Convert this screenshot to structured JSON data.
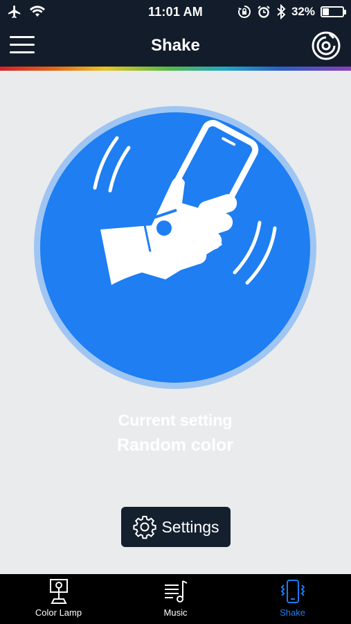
{
  "status_bar": {
    "time": "11:01 AM",
    "battery_percent": "32%",
    "battery_level": 0.32,
    "icons": [
      "airplane-icon",
      "wifi-icon",
      "orientation-lock-icon",
      "alarm-icon",
      "bluetooth-icon",
      "battery-icon"
    ]
  },
  "nav": {
    "title": "Shake",
    "menu_icon": "hamburger-menu-icon",
    "device_icon": "device-disc-icon"
  },
  "main": {
    "illustration": "hand-shaking-phone",
    "current_label": "Current setting",
    "current_value": "Random color"
  },
  "settings_button": {
    "label": "Settings",
    "icon": "gear-icon"
  },
  "tabs": [
    {
      "label": "Color Lamp",
      "icon": "lamp-icon",
      "active": false
    },
    {
      "label": "Music",
      "icon": "music-note-icon",
      "active": false
    },
    {
      "label": "Shake",
      "icon": "shake-phone-icon",
      "active": true
    }
  ],
  "colors": {
    "bar_background": "#121c2a",
    "circle_blue": "#1e7ef2",
    "circle_ring": "#9fc5f3",
    "active_tab": "#1f7bf0",
    "page_background": "#eaebed"
  }
}
